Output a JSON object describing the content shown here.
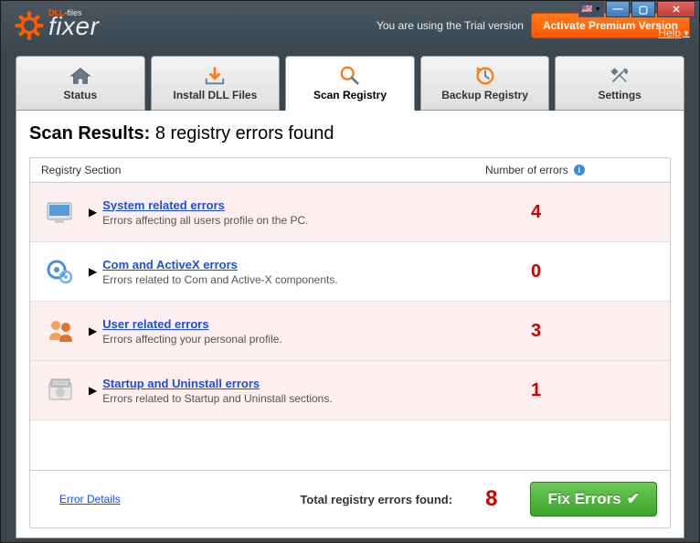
{
  "titlebar": {
    "brand_small_prefix": "DLL",
    "brand_small_suffix": "-files",
    "brand_main": "fixer",
    "trial_text": "You are using the Trial version",
    "activate_label": "Activate Premium Version",
    "help_label": "Help",
    "flag": "🇺🇸"
  },
  "tabs": [
    {
      "label": "Status"
    },
    {
      "label": "Install DLL Files"
    },
    {
      "label": "Scan Registry"
    },
    {
      "label": "Backup Registry"
    },
    {
      "label": "Settings"
    }
  ],
  "active_tab": 2,
  "results": {
    "heading_bold": "Scan Results:",
    "heading_rest": " 8 registry errors found",
    "col_section": "Registry Section",
    "col_errors": "Number of errors",
    "rows": [
      {
        "title": "System related errors",
        "desc": "Errors affecting all users profile on the PC.",
        "count": 4,
        "has_errors": true
      },
      {
        "title": "Com and ActiveX errors",
        "desc": "Errors related to Com and Active-X components.",
        "count": 0,
        "has_errors": false
      },
      {
        "title": "User related errors",
        "desc": "Errors affecting your personal profile.",
        "count": 3,
        "has_errors": true
      },
      {
        "title": "Startup and Uninstall errors",
        "desc": "Errors related to Startup and Uninstall sections.",
        "count": 1,
        "has_errors": true
      }
    ],
    "footer": {
      "error_details": "Error Details",
      "total_label": "Total registry errors found:",
      "total": 8,
      "fix_label": "Fix Errors"
    }
  }
}
